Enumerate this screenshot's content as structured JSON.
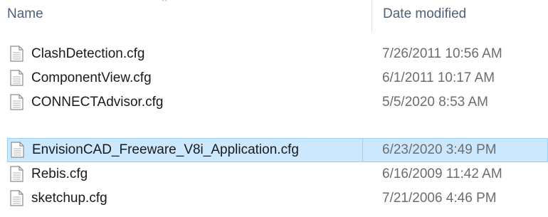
{
  "columns": {
    "name_label": "Name",
    "date_label": "Date modified",
    "sort_glyph": "^"
  },
  "files": [
    {
      "name": "ClashDetection.cfg",
      "date": "7/26/2011 10:56 AM",
      "icon": "document-icon"
    },
    {
      "name": "ComponentView.cfg",
      "date": "6/1/2011 10:17 AM",
      "icon": "document-icon"
    },
    {
      "name": "CONNECTAdvisor.cfg",
      "date": "5/5/2020 8:53 AM",
      "icon": "document-icon"
    },
    {
      "name": "EnvisionCAD_Freeware_V8i_Application.cfg",
      "date": "6/23/2020 3:49 PM",
      "icon": "document-icon",
      "selected": true
    },
    {
      "name": "Rebis.cfg",
      "date": "6/16/2009 11:42 AM",
      "icon": "document-icon"
    },
    {
      "name": "sketchup.cfg",
      "date": "7/21/2006 4:46 PM",
      "icon": "document-icon"
    }
  ],
  "colors": {
    "header_text": "#4c607a",
    "date_text": "#6d6d6d",
    "selection_fill": "#cce8ff",
    "selection_border": "#99d1ff"
  }
}
